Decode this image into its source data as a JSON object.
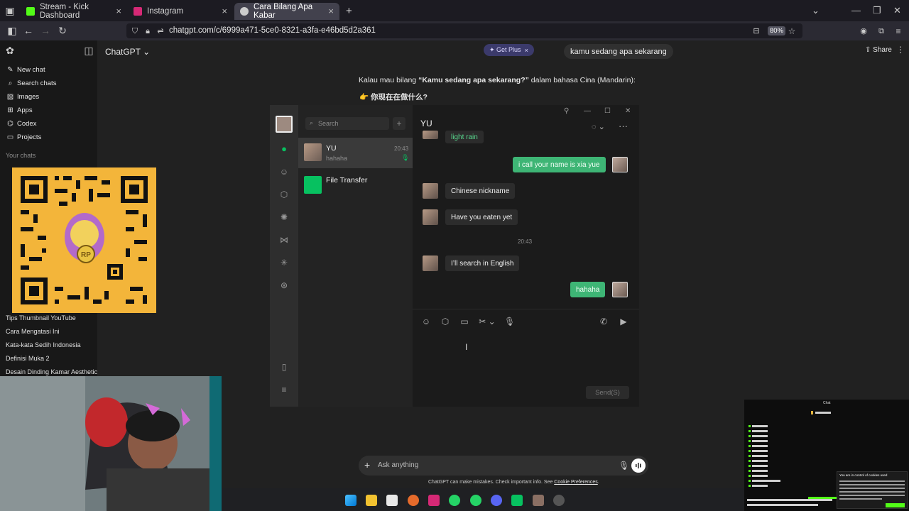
{
  "browser": {
    "tabs": [
      {
        "label": "Stream - Kick Dashboard",
        "color": "#53fc18"
      },
      {
        "label": "Instagram",
        "color": "#d62976"
      },
      {
        "label": "Cara Bilang Apa Kabar",
        "color": "#cccccc"
      }
    ],
    "url": "chatgpt.com/c/6999a471-5ce0-8321-a3fa-e46bd5d2a361",
    "zoom": "80%"
  },
  "chatgpt": {
    "model": "ChatGPT",
    "get_plus": "✦ Get Plus",
    "chat_title": "kamu sedang apa sekarang",
    "share": "Share",
    "sidebar": {
      "items": [
        {
          "label": "New chat",
          "icon": "pencil-icon"
        },
        {
          "label": "Search chats",
          "icon": "search-icon"
        },
        {
          "label": "Images",
          "icon": "image-icon"
        },
        {
          "label": "Apps",
          "icon": "apps-icon"
        },
        {
          "label": "Codex",
          "icon": "codex-icon"
        },
        {
          "label": "Projects",
          "icon": "folder-icon"
        }
      ],
      "your_chats": "Your chats",
      "chats": [
        "Tips Thumbnail YouTube",
        "Cara Mengatasi Ini",
        "Kata-kata Sedih Indonesia",
        "Definisi Muka 2",
        "Desain Dinding Kamar Aesthetic"
      ]
    },
    "message_line1_pre": "Kalau mau bilang ",
    "message_line1_bold": "“Kamu sedang apa sekarang?”",
    "message_line1_post": " dalam bahasa Cina (Mandarin):",
    "message_line2": "👉 你现在在做什么?",
    "prompt_placeholder": "Ask anything",
    "disclaimer": "ChatGPT can make mistakes. Check important info. See ",
    "disclaimer_link": "Cookie Preferences"
  },
  "wechat": {
    "search_placeholder": "Search",
    "conversations": [
      {
        "name": "YU",
        "preview": "hahaha",
        "time": "20:43"
      },
      {
        "name": "File Transfer"
      }
    ],
    "chat_title": "YU",
    "messages": [
      {
        "text": "light rain",
        "dir": "in"
      },
      {
        "text": "i call your name is xia yue",
        "dir": "out"
      },
      {
        "text": "Chinese nickname",
        "dir": "in"
      },
      {
        "text": "Have you eaten yet",
        "dir": "in"
      },
      {
        "text": "I’ll search in English",
        "dir": "in"
      },
      {
        "text": "hahaha",
        "dir": "out"
      }
    ],
    "timestamp": "20:43",
    "send_label": "Send(S)"
  },
  "overlays": {
    "kick_chat_title": "Chat",
    "cookie_title": "You are in control of cookies used"
  }
}
